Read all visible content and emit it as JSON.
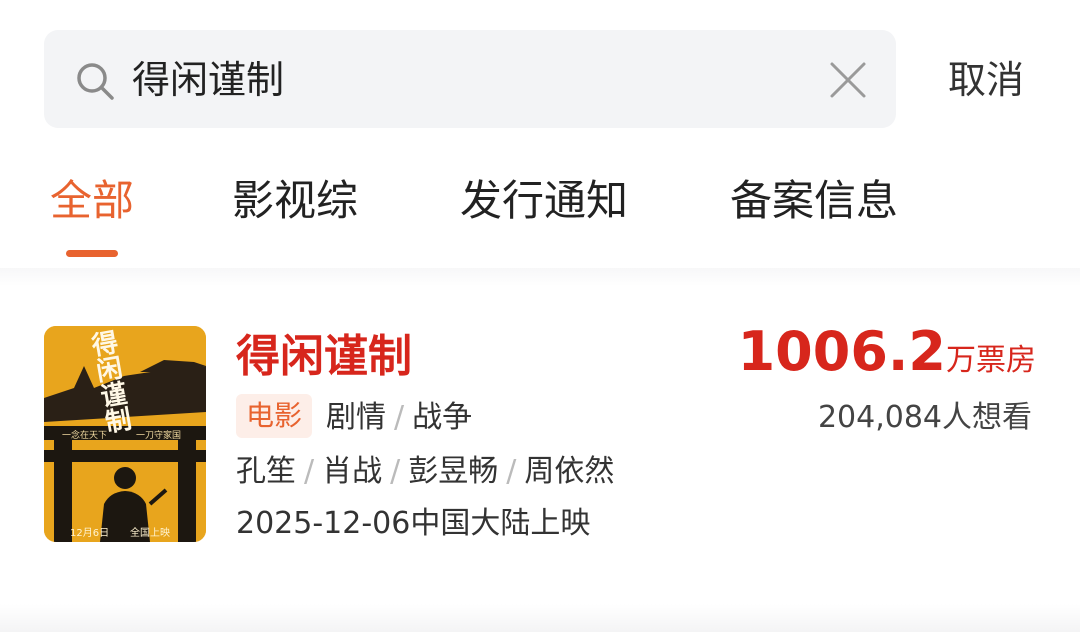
{
  "search": {
    "query": "得闲谨制",
    "cancel_label": "取消"
  },
  "tabs": [
    {
      "label": "全部",
      "active": true
    },
    {
      "label": "影视综",
      "active": false
    },
    {
      "label": "发行通知",
      "active": false
    },
    {
      "label": "备案信息",
      "active": false
    }
  ],
  "result": {
    "title": "得闲谨制",
    "type": "电影",
    "genres": [
      "剧情",
      "战争"
    ],
    "cast": [
      "孔笙",
      "肖战",
      "彭昱畅",
      "周依然"
    ],
    "release": "2025-12-06中国大陆上映",
    "box_office_value": "1006.2",
    "box_office_unit": "万票房",
    "want_to_see": "204,084人想看",
    "poster": {
      "title_text": "得闲谨制",
      "date_text": "12月6日",
      "slogan_left": "一念在天下",
      "slogan_right": "一刀守家国",
      "bottom_text": "全国上映"
    }
  },
  "colors": {
    "accent": "#e8632f",
    "title_red": "#d7261c",
    "poster_yellow": "#e8a51d"
  }
}
